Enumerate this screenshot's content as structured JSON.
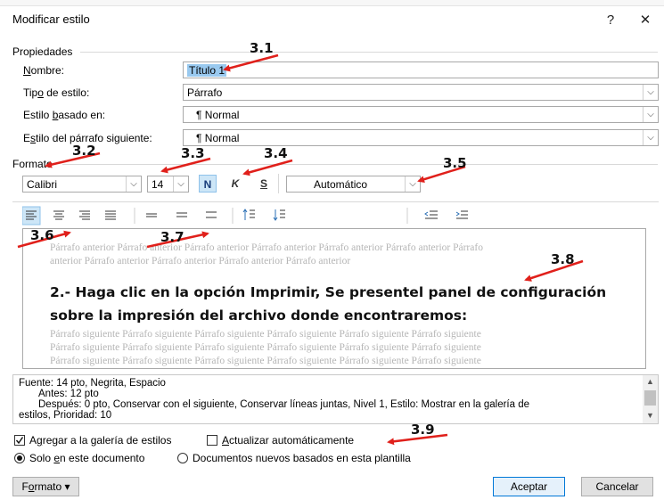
{
  "window": {
    "title": "Modificar estilo",
    "help_glyph": "?",
    "close_glyph": "✕"
  },
  "properties": {
    "section_label": "Propiedades",
    "name_label_pre": "",
    "name_label_u": "N",
    "name_label_post": "ombre:",
    "name_value": "Título 1",
    "type_label_pre": "Tip",
    "type_label_u": "o",
    "type_label_post": " de estilo:",
    "type_value": "Párrafo",
    "based_label_pre": "Estilo ",
    "based_label_u": "b",
    "based_label_post": "asado en:",
    "based_value": "¶  Normal",
    "next_label_pre": "E",
    "next_label_u": "s",
    "next_label_post": "tilo del párrafo siguiente:",
    "next_value": "¶  Normal"
  },
  "format": {
    "section_label": "Formato",
    "font_name": "Calibri",
    "font_size": "14",
    "bold": "N",
    "italic": "K",
    "underline": "S",
    "color": "Automático"
  },
  "preview": {
    "prev_line1": "Párrafo anterior Párrafo anterior Párrafo anterior Párrafo anterior Párrafo anterior Párrafo anterior Párrafo",
    "prev_line2": "anterior Párrafo anterior Párrafo anterior Párrafo anterior Párrafo anterior",
    "heading_line1": "2.- Haga clic en la opción Imprimir, Se presentel panel de configuración",
    "heading_line2": "sobre la impresión del archivo donde encontraremos:",
    "next_line": "Párrafo siguiente Párrafo siguiente Párrafo siguiente Párrafo siguiente Párrafo siguiente Párrafo siguiente"
  },
  "description": {
    "line1": "Fuente: 14 pto, Negrita, Espacio",
    "line2": "Antes:  12 pto",
    "line3": "Después:  0 pto, Conservar con el siguiente, Conservar líneas juntas, Nivel 1, Estilo: Mostrar en la galería de",
    "line4": "estilos, Prioridad: 10"
  },
  "options": {
    "add_gallery_pre": "A",
    "add_gallery_u": "g",
    "add_gallery_post": "regar a la galería de estilos",
    "add_gallery_checked": true,
    "auto_update_pre": "",
    "auto_update_u": "A",
    "auto_update_post": "ctualizar automáticamente",
    "auto_update_checked": false,
    "only_doc_pre": "Solo ",
    "only_doc_u": "e",
    "only_doc_post": "n este documento",
    "only_doc_selected": true,
    "new_docs": "Documentos nuevos basados en esta plantilla"
  },
  "buttons": {
    "format_pre": "F",
    "format_u": "o",
    "format_post": "rmato",
    "format_caret": "▾",
    "accept": "Aceptar",
    "cancel": "Cancelar"
  },
  "annotations": {
    "a31": "3.1",
    "a32": "3.2",
    "a33": "3.3",
    "a34": "3.4",
    "a35": "3.5",
    "a36": "3.6",
    "a37": "3.7",
    "a38": "3.8",
    "a39": "3.9",
    "arrow_color": "#e0201b"
  },
  "icons": {
    "dropdown": "chevron-down-icon",
    "scroll_up": "chevron-up-icon",
    "scroll_down": "chevron-down-icon"
  }
}
